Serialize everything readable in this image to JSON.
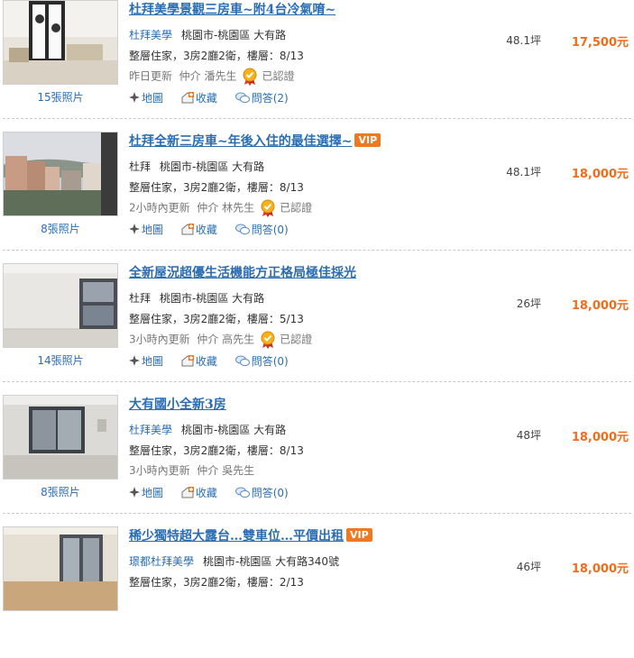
{
  "listings": [
    {
      "title": "杜拜美學景觀三房車~附4台冷氣唷~",
      "vip": "",
      "agency": "杜拜美學",
      "address": "桃園市-桃園區 大有路",
      "detail": "整層住家，3房2廳2衛，樓層：8/13",
      "update": "昨日更新",
      "agent": "仲介 潘先生",
      "verified": "已認證",
      "photos": "15張照片",
      "map": "地圖",
      "fav": "收藏",
      "qa": "問答(2)",
      "area": "48.1坪",
      "price": "17,500元"
    },
    {
      "title": "杜拜全新三房車~年後入住的最佳選擇~",
      "vip": "VIP",
      "agency": "杜拜",
      "address": "桃園市-桃園區 大有路",
      "detail": "整層住家，3房2廳2衛，樓層：8/13",
      "update": "2小時內更新",
      "agent": "仲介 林先生",
      "verified": "已認證",
      "photos": "8張照片",
      "map": "地圖",
      "fav": "收藏",
      "qa": "問答(0)",
      "area": "48.1坪",
      "price": "18,000元"
    },
    {
      "title": "全新屋況超優生活機能方正格局極佳採光",
      "vip": "",
      "agency": "杜拜",
      "address": "桃園市-桃園區 大有路",
      "detail": "整層住家，3房2廳2衛，樓層：5/13",
      "update": "3小時內更新",
      "agent": "仲介 高先生",
      "verified": "已認證",
      "photos": "14張照片",
      "map": "地圖",
      "fav": "收藏",
      "qa": "問答(0)",
      "area": "26坪",
      "price": "18,000元"
    },
    {
      "title": "大有國小全新3房",
      "vip": "",
      "agency": "杜拜美學",
      "address": "桃園市-桃園區 大有路",
      "detail": "整層住家，3房2廳2衛，樓層：8/13",
      "update": "3小時內更新",
      "agent": "仲介 吳先生",
      "verified": "",
      "photos": "8張照片",
      "map": "地圖",
      "fav": "收藏",
      "qa": "問答(0)",
      "area": "48坪",
      "price": "18,000元"
    },
    {
      "title": "稀少獨特超大露台…雙車位…平價出租",
      "vip": "VIP",
      "agency": "璟都杜拜美學",
      "address": "桃園市-桃園區 大有路340號",
      "detail": "整層住家，3房2廳2衛，樓層：2/13",
      "update": "",
      "agent": "",
      "verified": "",
      "photos": "",
      "map": "",
      "fav": "",
      "qa": "",
      "area": "46坪",
      "price": "18,000元"
    }
  ],
  "colors": {
    "link": "#2a6db3",
    "price": "#f26c1a",
    "vip": "#f07820"
  }
}
